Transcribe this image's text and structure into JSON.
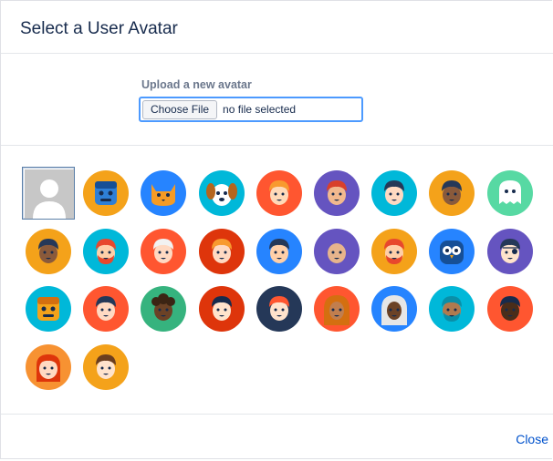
{
  "dialog": {
    "title": "Select a User Avatar",
    "upload_label": "Upload a new avatar",
    "choose_file_label": "Choose File",
    "file_status": "no file selected",
    "close_label": "Close"
  },
  "avatars": [
    {
      "bg": "#c7c7c7",
      "skin": "#ffffff",
      "hair": "none",
      "kind": "default-silhouette",
      "selected": true
    },
    {
      "bg": "#f4a21a",
      "skin": "#2e7fd6",
      "hair": "#164f96",
      "kind": "robot-blue"
    },
    {
      "bg": "#2684ff",
      "skin": "#f59b24",
      "hair": "#d46f10",
      "kind": "cat-orange"
    },
    {
      "bg": "#00b8d9",
      "skin": "#ffffff",
      "hair": "#b5651d",
      "kind": "dog"
    },
    {
      "bg": "#ff5630",
      "skin": "#ffd9b8",
      "hair": "#f89a2f",
      "kind": "person"
    },
    {
      "bg": "#6554c0",
      "skin": "#f2b98e",
      "hair": "#d9402b",
      "kind": "person"
    },
    {
      "bg": "#00b8d9",
      "skin": "#ffd9c2",
      "hair": "#253858",
      "kind": "person"
    },
    {
      "bg": "#f4a21a",
      "skin": "#8a5a3b",
      "hair": "#253858",
      "kind": "person"
    },
    {
      "bg": "#57d9a3",
      "skin": "#ffffff",
      "hair": "none",
      "kind": "ghost"
    },
    {
      "bg": "#f4a21a",
      "skin": "#8a5a3b",
      "hair": "#253858",
      "kind": "person"
    },
    {
      "bg": "#00b8d9",
      "skin": "#ffcfa8",
      "hair": "#e8482d",
      "kind": "person-beard"
    },
    {
      "bg": "#ff5630",
      "skin": "#ffd9c2",
      "hair": "#f2f2f2",
      "kind": "person"
    },
    {
      "bg": "#de350b",
      "skin": "#ffd9c2",
      "hair": "#f89a2f",
      "kind": "person"
    },
    {
      "bg": "#2684ff",
      "skin": "#ffcfa8",
      "hair": "#253858",
      "kind": "person"
    },
    {
      "bg": "#6554c0",
      "skin": "#e7b48c",
      "hair": "none",
      "kind": "person-bald"
    },
    {
      "bg": "#f4a21a",
      "skin": "#ffcfa8",
      "hair": "#e8482d",
      "kind": "person-beard"
    },
    {
      "bg": "#2684ff",
      "skin": "#57d9f5",
      "hair": "#164f96",
      "kind": "owl"
    },
    {
      "bg": "#6554c0",
      "skin": "#ffe3cc",
      "hair": "#253858",
      "kind": "pirate"
    },
    {
      "bg": "#00b8d9",
      "skin": "#f4a21a",
      "hair": "#d46f10",
      "kind": "robot-yellow"
    },
    {
      "bg": "#ff5630",
      "skin": "#ffd9c2",
      "hair": "#253858",
      "kind": "person"
    },
    {
      "bg": "#36b37e",
      "skin": "#6b4226",
      "hair": "#3b2414",
      "kind": "person-curly"
    },
    {
      "bg": "#de350b",
      "skin": "#ffe3cc",
      "hair": "#172b4d",
      "kind": "person"
    },
    {
      "bg": "#253858",
      "skin": "#ffe3cc",
      "hair": "#ff5630",
      "kind": "person"
    },
    {
      "bg": "#ff5630",
      "skin": "#c17e4e",
      "hair": "#d46f10",
      "kind": "hijab"
    },
    {
      "bg": "#2684ff",
      "skin": "#6b4226",
      "hair": "#e6e6e6",
      "kind": "hijab"
    },
    {
      "bg": "#00b8d9",
      "skin": "#b07a4f",
      "hair": "#0a8fa8",
      "kind": "person-beard"
    },
    {
      "bg": "#ff5630",
      "skin": "#4a2d1a",
      "hair": "#172b4d",
      "kind": "person"
    },
    {
      "bg": "#f79232",
      "skin": "#ffd9c2",
      "hair": "#de350b",
      "kind": "person-longhair"
    },
    {
      "bg": "#f4a21a",
      "skin": "#ffe3cc",
      "hair": "#6b3e1f",
      "kind": "person"
    }
  ]
}
